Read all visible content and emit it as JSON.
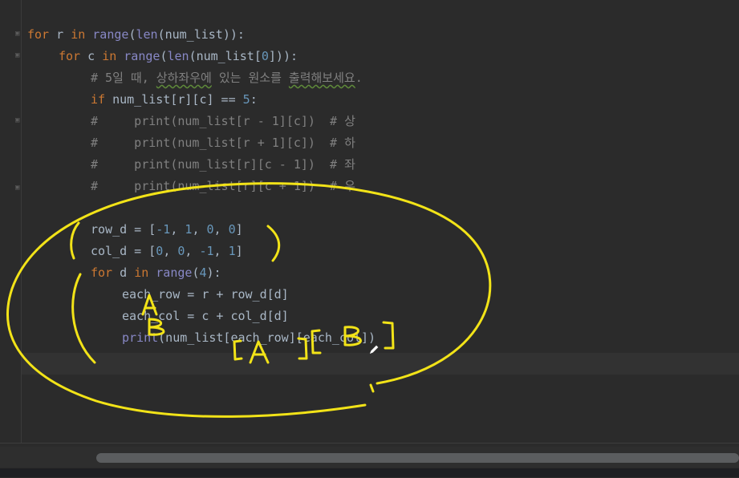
{
  "editor": {
    "lines": [
      {
        "tokens": [
          {
            "t": "for",
            "c": "kw"
          },
          {
            "t": " r ",
            "c": "op"
          },
          {
            "t": "in",
            "c": "kw"
          },
          {
            "t": " ",
            "c": "op"
          },
          {
            "t": "range",
            "c": "fn"
          },
          {
            "t": "(",
            "c": "op"
          },
          {
            "t": "len",
            "c": "fn"
          },
          {
            "t": "(num_list)):",
            "c": "op"
          }
        ]
      },
      {
        "tokens": [
          {
            "t": "for",
            "c": "kw"
          },
          {
            "t": " c ",
            "c": "op"
          },
          {
            "t": "in",
            "c": "kw"
          },
          {
            "t": " ",
            "c": "op"
          },
          {
            "t": "range",
            "c": "fn"
          },
          {
            "t": "(",
            "c": "op"
          },
          {
            "t": "len",
            "c": "fn"
          },
          {
            "t": "(num_list[",
            "c": "op"
          },
          {
            "t": "0",
            "c": "num"
          },
          {
            "t": "])):",
            "c": "op"
          }
        ]
      },
      {
        "tokens": [
          {
            "t": "# 5일 때, ",
            "c": "cm"
          },
          {
            "t": "상하좌우에",
            "c": "cm squiggle"
          },
          {
            "t": " 있는 원소를 ",
            "c": "cm"
          },
          {
            "t": "출력해보세요",
            "c": "cm squiggle"
          },
          {
            "t": ".",
            "c": "cm"
          }
        ]
      },
      {
        "tokens": [
          {
            "t": "if",
            "c": "kw"
          },
          {
            "t": " num_list[r][c] == ",
            "c": "op"
          },
          {
            "t": "5",
            "c": "num"
          },
          {
            "t": ":",
            "c": "op"
          }
        ]
      },
      {
        "tokens": [
          {
            "t": "#     print(num_list[r - 1][c])  # 상",
            "c": "cm"
          }
        ]
      },
      {
        "tokens": [
          {
            "t": "#     print(num_list[r + 1][c])  # 하",
            "c": "cm"
          }
        ]
      },
      {
        "tokens": [
          {
            "t": "#     print(num_list[r][c - 1])  # 좌",
            "c": "cm"
          }
        ]
      },
      {
        "tokens": [
          {
            "t": "#     print(num_list[r][c + 1])  # 우",
            "c": "cm"
          }
        ]
      },
      {
        "tokens": []
      },
      {
        "tokens": [
          {
            "t": "row_d = [",
            "c": "op"
          },
          {
            "t": "-1",
            "c": "num"
          },
          {
            "t": ", ",
            "c": "op"
          },
          {
            "t": "1",
            "c": "num"
          },
          {
            "t": ", ",
            "c": "op"
          },
          {
            "t": "0",
            "c": "num"
          },
          {
            "t": ", ",
            "c": "op"
          },
          {
            "t": "0",
            "c": "num"
          },
          {
            "t": "]",
            "c": "op"
          }
        ]
      },
      {
        "tokens": [
          {
            "t": "col_d = [",
            "c": "op"
          },
          {
            "t": "0",
            "c": "num"
          },
          {
            "t": ", ",
            "c": "op"
          },
          {
            "t": "0",
            "c": "num"
          },
          {
            "t": ", ",
            "c": "op"
          },
          {
            "t": "-1",
            "c": "num"
          },
          {
            "t": ", ",
            "c": "op"
          },
          {
            "t": "1",
            "c": "num"
          },
          {
            "t": "]",
            "c": "op"
          }
        ]
      },
      {
        "tokens": [
          {
            "t": "for",
            "c": "kw"
          },
          {
            "t": " d ",
            "c": "op"
          },
          {
            "t": "in",
            "c": "kw"
          },
          {
            "t": " ",
            "c": "op"
          },
          {
            "t": "range",
            "c": "fn"
          },
          {
            "t": "(",
            "c": "op"
          },
          {
            "t": "4",
            "c": "num"
          },
          {
            "t": "):",
            "c": "op"
          }
        ]
      },
      {
        "tokens": [
          {
            "t": "each_row = r + row_d[d]",
            "c": "op"
          }
        ]
      },
      {
        "tokens": [
          {
            "t": "each_col = c + col_d[d]",
            "c": "op"
          }
        ]
      },
      {
        "tokens": [
          {
            "t": "print",
            "c": "fn"
          },
          {
            "t": "(num_list[each_row][each_col])",
            "c": "op"
          }
        ]
      }
    ]
  },
  "annotations": {
    "letters": [
      "A",
      "B",
      "[A][B]"
    ]
  },
  "colors": {
    "background": "#2b2b2b",
    "keyword": "#cc7832",
    "builtin": "#8888c6",
    "number": "#6897bb",
    "comment": "#808080",
    "text": "#a9b7c6",
    "ink": "#f2e318"
  }
}
